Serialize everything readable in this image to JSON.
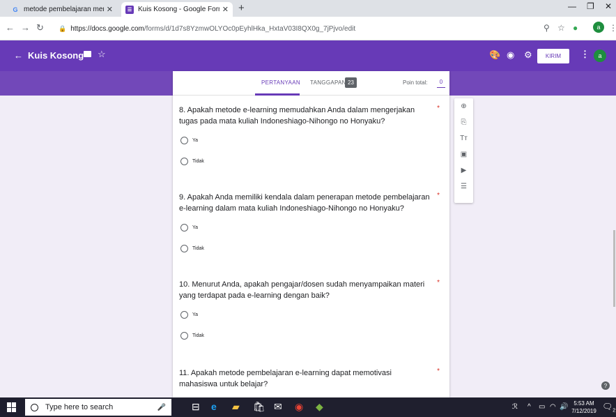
{
  "browser": {
    "tabs": [
      {
        "title": "metode pembelajaran menurut",
        "favicon": "google-g-icon"
      },
      {
        "title": "Kuis Kosong - Google Formulir",
        "favicon": "google-forms-icon"
      }
    ],
    "url_host": "https://docs.google.com",
    "url_path": "/forms/d/1d7s8YzmwOLYOc0pEyhlHka_HxtaV03I8QX0g_7jPjvo/edit",
    "profile_initial": "a"
  },
  "forms_header": {
    "title": "Kuis Kosong",
    "send_label": "KIRIM",
    "avatar_initial": "a",
    "accent": "#673ab7"
  },
  "form_tabs": {
    "questions_label": "PERTANYAAN",
    "responses_label": "TANGGAPAN",
    "responses_count": "23",
    "points_label": "Poin total:",
    "points_value": "0"
  },
  "questions": [
    {
      "text": "8. Apakah metode e-learning memudahkan Anda dalam mengerjakan tugas pada mata kuliah Indoneshiago-Nihongo no Honyaku?",
      "required": "*",
      "options": [
        "Ya",
        "Tidak"
      ]
    },
    {
      "text": "9. Apakah Anda memiliki kendala dalam penerapan metode pembelajaran e-learning dalam mata kuliah Indoneshiago-Nihongo no Honyaku?",
      "required": "*",
      "options": [
        "Ya",
        "Tidak"
      ]
    },
    {
      "text": "10. Menurut Anda, apakah pengajar/dosen sudah menyampaikan materi yang terdapat pada e-learning dengan baik?",
      "required": "*",
      "options": [
        "Ya",
        "Tidak"
      ]
    },
    {
      "text": "11. Apakah metode pembelajaran e-learning dapat memotivasi mahasiswa untuk belajar?",
      "required": "*",
      "options": []
    }
  ],
  "taskbar": {
    "search_placeholder": "Type here to search",
    "time": "5:53 AM",
    "date": "7/12/2019",
    "notification_count": "2"
  }
}
